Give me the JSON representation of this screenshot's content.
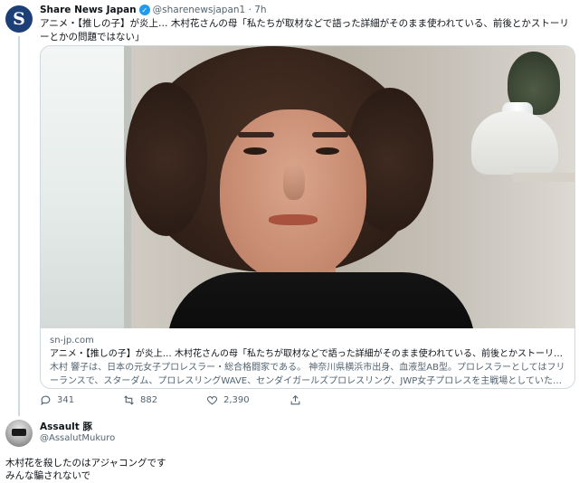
{
  "tweet": {
    "author_name": "Share News Japan",
    "avatar_letter": "S",
    "handle_time": "@sharenewsjapan1 · 7h",
    "text": "アニメ・【推しの子】が炎上… 木村花さんの母「私たちが取材などで語った詳細がそのまま使われている、前後とかストーリーとかの問題ではない」",
    "card": {
      "domain": "sn-jp.com",
      "title": "アニメ・【推しの子】が炎上… 木村花さんの母「私たちが取材などで語った詳細がそのまま使われている、前後とかストーリーとか…",
      "description": "木村 響子は、日本の元女子プロレスラー・総合格闘家である。 神奈川県横浜市出身、血液型AB型。プロレスラーとしてはフリーランスで、スターダム、プロレスリングWAVE、センダイガールズプロレスリング、JWP女子プロレスを主戦場としていた。総合格闘家と…"
    },
    "actions": {
      "replies": "341",
      "retweets": "882",
      "likes": "2,390"
    }
  },
  "reply": {
    "author_name": "Assault 豚",
    "handle": "@AssalutMukuro",
    "line1": "木村花を殺したのはアジャコングです",
    "line2": "みんな騙されないで"
  },
  "colors": {
    "text": "#0f1419",
    "secondary": "#536471",
    "verified": "#1d9bf0",
    "border": "#cfd9de"
  }
}
